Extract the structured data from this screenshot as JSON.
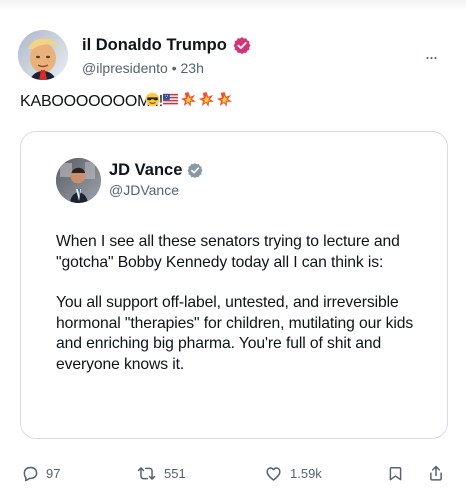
{
  "post": {
    "display_name": "il Donaldo Trumpo",
    "handle": "@ilpresidento",
    "separator": "•",
    "time": "23h",
    "text": "KABOOOOOOOM!!!",
    "more_label": "...",
    "icons": {
      "verified": "verified-badge-icon",
      "more": "more-options-icon",
      "emoji": [
        "sunglasses-emoji-icon",
        "us-flag-emoji-icon",
        "collision-emoji-icon",
        "collision-emoji-icon",
        "collision-emoji-icon"
      ]
    },
    "colors": {
      "verified_badge": "#d23577",
      "secondary_text": "#536471"
    }
  },
  "quote": {
    "display_name": "JD Vance",
    "handle": "@JDVance",
    "paragraphs": [
      "When I see all these senators trying to lecture and \"gotcha\" Bobby Kennedy today all I can think is:",
      "You all support off-label, untested, and irreversible hormonal \"therapies\" for children, mutilating our kids and enriching big pharma. You're full of shit and everyone knows it."
    ],
    "icons": {
      "verified": "verified-badge-icon"
    },
    "colors": {
      "verified_badge": "#8899a6"
    }
  },
  "actions": {
    "reply_count": "97",
    "retweet_count": "551",
    "like_count": "1.59k",
    "icons": [
      "reply-icon",
      "retweet-icon",
      "like-icon",
      "bookmark-icon",
      "share-icon"
    ]
  }
}
